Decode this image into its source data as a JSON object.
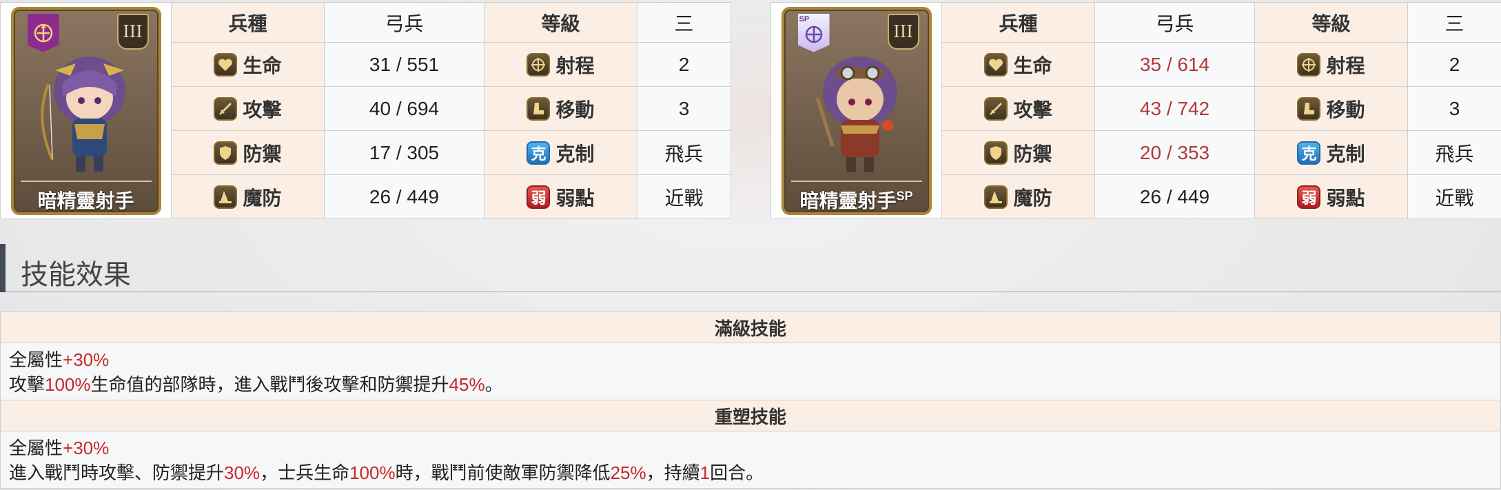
{
  "units": [
    {
      "name": "暗精靈射手",
      "sp": "",
      "rank": "III",
      "labels": {
        "type": "兵種",
        "grade": "等級",
        "hp": "生命",
        "range": "射程",
        "atk": "攻擊",
        "move": "移動",
        "def": "防禦",
        "counter": "克制",
        "mdef": "魔防",
        "weak": "弱點"
      },
      "values": {
        "type": "弓兵",
        "grade": "三",
        "hp_min": "31",
        "hp_max": "551",
        "range": "2",
        "atk_min": "40",
        "atk_max": "694",
        "move": "3",
        "def_min": "17",
        "def_max": "305",
        "counter": "飛兵",
        "mdef_min": "26",
        "mdef_max": "449",
        "weak": "近戰"
      }
    },
    {
      "name": "暗精靈射手",
      "sp": "SP",
      "rank": "III",
      "labels": {
        "type": "兵種",
        "grade": "等級",
        "hp": "生命",
        "range": "射程",
        "atk": "攻擊",
        "move": "移動",
        "def": "防禦",
        "counter": "克制",
        "mdef": "魔防",
        "weak": "弱點"
      },
      "values": {
        "type": "弓兵",
        "grade": "三",
        "hp_min": "35",
        "hp_max": "614",
        "range": "2",
        "atk_min": "43",
        "atk_max": "742",
        "move": "3",
        "def_min": "20",
        "def_max": "353",
        "counter": "飛兵",
        "mdef_min": "26",
        "mdef_max": "449",
        "weak": "近戰"
      }
    }
  ],
  "icon_glyphs": {
    "counter": "克",
    "weak": "弱"
  },
  "sp_badge": "SP",
  "skills": {
    "title": "技能效果",
    "blocks": [
      {
        "header": "滿級技能",
        "line1": {
          "a": "全屬性",
          "b": "+30%"
        },
        "line2": {
          "a": "攻擊",
          "b": "100%",
          "c": "生命值的部隊時，進入戰鬥後攻擊和防禦提升",
          "d": "45%",
          "e": "。"
        }
      },
      {
        "header": "重塑技能",
        "line1": {
          "a": "全屬性",
          "b": "+30%"
        },
        "line2": {
          "a": "進入戰鬥時攻擊、防禦提升",
          "b": "30%",
          "c": "，士兵生命",
          "d": "100%",
          "e": "時，戰鬥前使敵軍防禦降低",
          "f": "25%",
          "g": "，持續",
          "h": "1",
          "i": "回合。"
        }
      }
    ]
  },
  "colors": {
    "label_bg": "#fbeee4",
    "value_bg": "#f8f9fb",
    "highlight": "#c62828",
    "sp_value": "#b03a3a"
  }
}
